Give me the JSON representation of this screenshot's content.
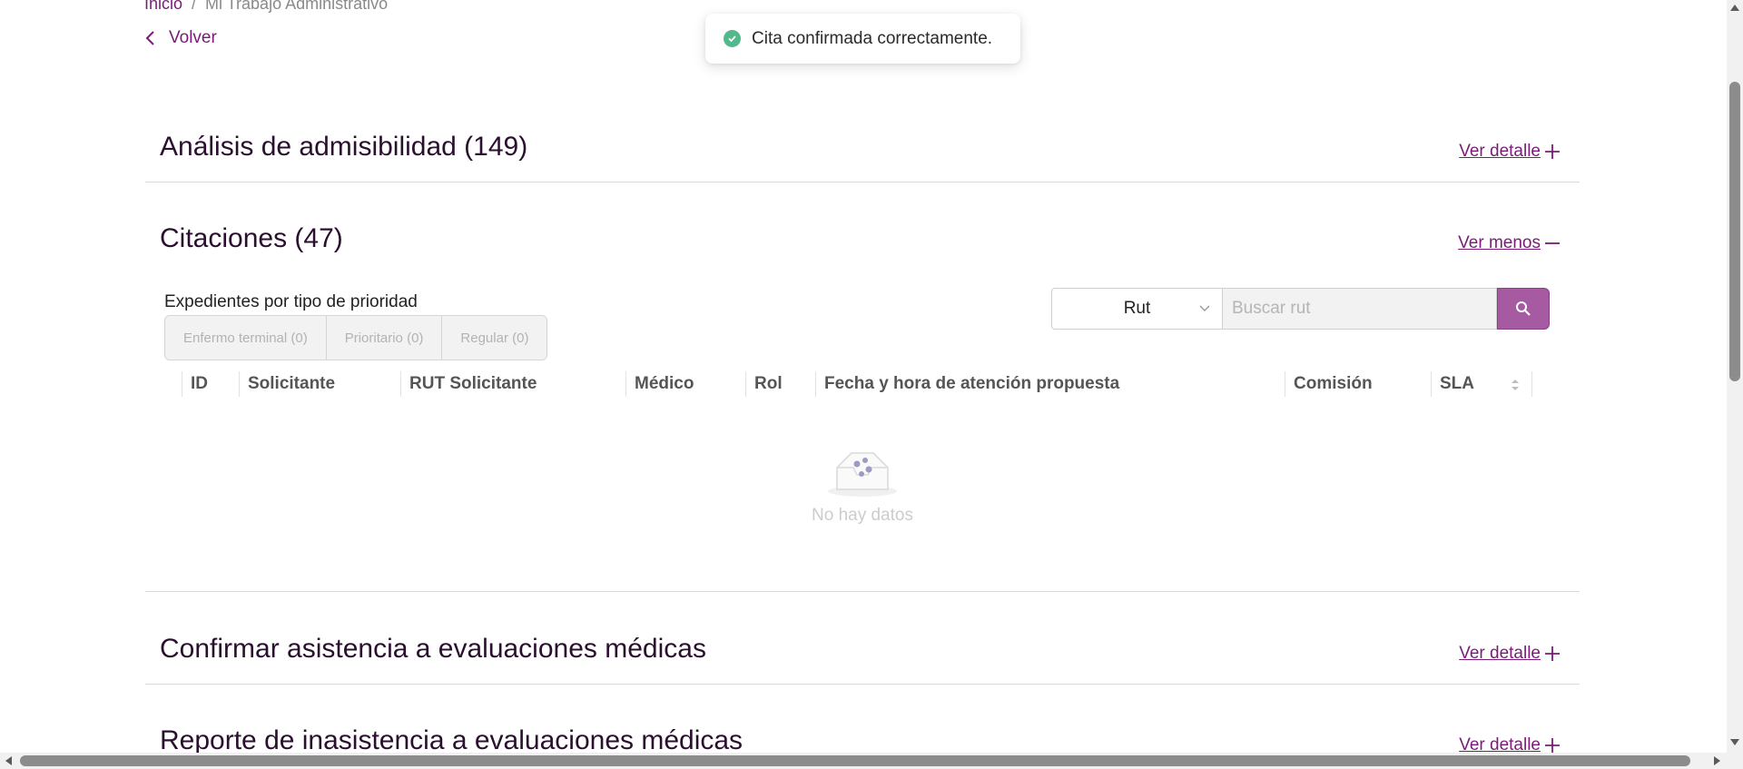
{
  "breadcrumb": {
    "home": "Inicio",
    "separator": "/",
    "current": "Mi Trabajo Administrativo"
  },
  "back": {
    "label": "Volver"
  },
  "toast": {
    "message": "Cita confirmada correctamente.",
    "status_color": "#52b98a"
  },
  "sections": [
    {
      "title": "Análisis de admisibilidad (149)",
      "action": "Ver detalle ",
      "icon": "plus-icon"
    },
    {
      "title": "Citaciones (47)",
      "action": "Ver menos ",
      "icon": "minus-icon"
    },
    {
      "title": "Confirmar asistencia a evaluaciones médicas",
      "action": "Ver detalle ",
      "icon": "plus-icon"
    },
    {
      "title": "Reporte de inasistencia a evaluaciones médicas",
      "action": "Ver detalle ",
      "icon": "plus-icon"
    }
  ],
  "citaciones": {
    "priority_label": "Expedientes por tipo de prioridad",
    "priority_filters": [
      "Enfermo terminal (0)",
      "Prioritario (0)",
      "Regular (0)"
    ],
    "search": {
      "select_value": "Rut",
      "placeholder": "Buscar rut"
    },
    "columns": [
      "ID",
      "Solicitante",
      "RUT Solicitante",
      "Médico",
      "Rol",
      "Fecha y hora de atención propuesta",
      "Comisión",
      "SLA"
    ],
    "empty_text": "No hay datos"
  },
  "colors": {
    "accent": "#7b1a78",
    "search_button": "#a55aa2"
  }
}
